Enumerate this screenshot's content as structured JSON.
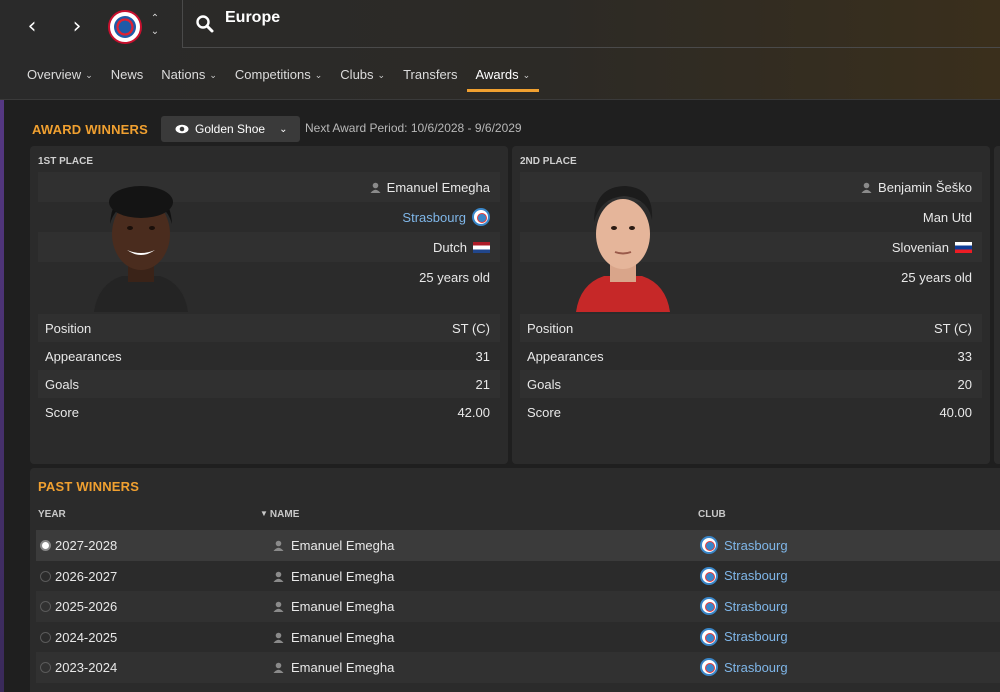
{
  "header": {
    "search_text": "Europe"
  },
  "tabs": [
    {
      "label": "Overview",
      "dropdown": true
    },
    {
      "label": "News",
      "dropdown": false
    },
    {
      "label": "Nations",
      "dropdown": true
    },
    {
      "label": "Competitions",
      "dropdown": true
    },
    {
      "label": "Clubs",
      "dropdown": true
    },
    {
      "label": "Transfers",
      "dropdown": false
    },
    {
      "label": "Awards",
      "dropdown": true,
      "active": true
    }
  ],
  "awards": {
    "title": "AWARD WINNERS",
    "selected_award": "Golden Shoe",
    "next_period": "Next Award Period: 10/6/2028 - 9/6/2029"
  },
  "winners": [
    {
      "place": "1ST PLACE",
      "name": "Emanuel Emegha",
      "club": "Strasbourg",
      "nationality": "Dutch",
      "age": "25 years old",
      "stats": [
        {
          "label": "Position",
          "value": "ST (C)"
        },
        {
          "label": "Appearances",
          "value": "31"
        },
        {
          "label": "Goals",
          "value": "21"
        },
        {
          "label": "Score",
          "value": "42.00"
        }
      ]
    },
    {
      "place": "2ND PLACE",
      "name": "Benjamin Šeško",
      "club": "Man Utd",
      "nationality": "Slovenian",
      "age": "25 years old",
      "stats": [
        {
          "label": "Position",
          "value": "ST (C)"
        },
        {
          "label": "Appearances",
          "value": "33"
        },
        {
          "label": "Goals",
          "value": "20"
        },
        {
          "label": "Score",
          "value": "40.00"
        }
      ]
    }
  ],
  "past_winners": {
    "title": "PAST WINNERS",
    "columns": {
      "year": "YEAR",
      "name": "NAME",
      "club": "CLUB"
    },
    "rows": [
      {
        "year": "2027-2028",
        "name": "Emanuel Emegha",
        "club": "Strasbourg"
      },
      {
        "year": "2026-2027",
        "name": "Emanuel Emegha",
        "club": "Strasbourg"
      },
      {
        "year": "2025-2026",
        "name": "Emanuel Emegha",
        "club": "Strasbourg"
      },
      {
        "year": "2024-2025",
        "name": "Emanuel Emegha",
        "club": "Strasbourg"
      },
      {
        "year": "2023-2024",
        "name": "Emanuel Emegha",
        "club": "Strasbourg"
      }
    ]
  },
  "colors": {
    "accent": "#f0a030",
    "link": "#7fb6e8",
    "panel": "#2b2b2b"
  }
}
